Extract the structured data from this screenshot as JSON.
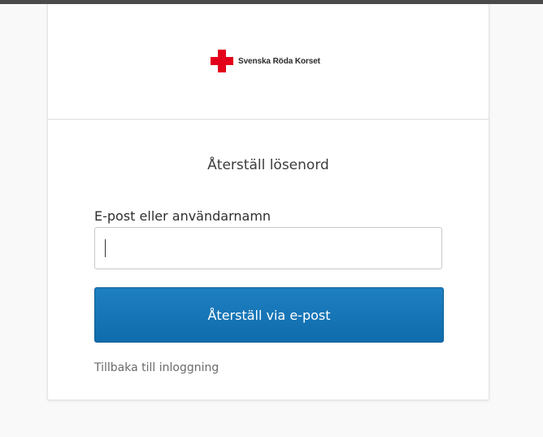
{
  "brand": {
    "name": "Svenska Röda Korset",
    "logo_icon": "red-cross-icon",
    "logo_color": "#e3001b"
  },
  "form": {
    "title": "Återställ lösenord",
    "field_label": "E-post eller användarnamn",
    "field_value": "",
    "submit_label": "Återställ via e-post",
    "back_link_label": "Tillbaka till inloggning"
  },
  "colors": {
    "accent": "#1473b7",
    "page_background": "#f9f9f9"
  }
}
